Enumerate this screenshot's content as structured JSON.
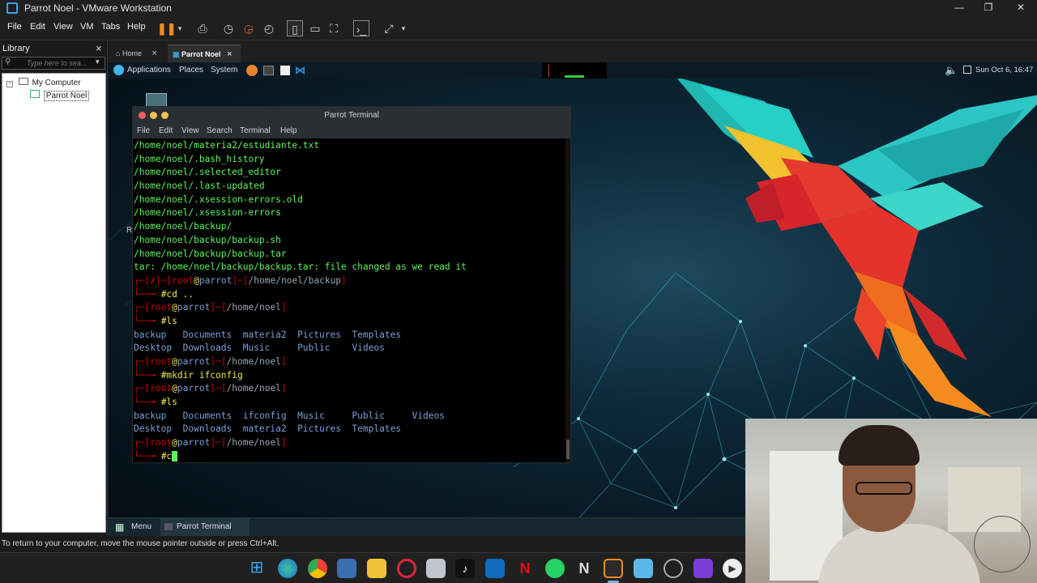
{
  "window": {
    "title": "Parrot Noel - VMware Workstation"
  },
  "menubar": {
    "items": [
      "File",
      "Edit",
      "View",
      "VM",
      "Tabs",
      "Help"
    ]
  },
  "library": {
    "header": "Library",
    "search_placeholder": "Type here to sea...",
    "tree": {
      "root": "My Computer",
      "child": "Parrot Noel"
    }
  },
  "vm_tabs": [
    {
      "label": "Home"
    },
    {
      "label": "Parrot Noel"
    }
  ],
  "guest_panel": {
    "menus": [
      "Applications",
      "Places",
      "System"
    ],
    "clock": "Sun Oct 6, 16:47"
  },
  "terminal": {
    "title": "Parrot Terminal",
    "menu": [
      "File",
      "Edit",
      "View",
      "Search",
      "Terminal",
      "Help"
    ],
    "output_lines": [
      "/home/noel/materia2/estudiante.txt",
      "/home/noel/.bash_history",
      "/home/noel/.selected_editor",
      "/home/noel/.last-updated",
      "/home/noel/.xsession-errors.old",
      "/home/noel/.xsession-errors",
      "/home/noel/backup/",
      "/home/noel/backup/backup.sh",
      "/home/noel/backup/backup.tar",
      "tar: /home/noel/backup/backup.tar: file changed as we read it"
    ],
    "prompt_user": "root",
    "prompt_host": "parrot",
    "error_mark": "✗",
    "cwd_backup": "/home/noel/backup",
    "cwd_home": "/home/noel",
    "cmd1": "#cd ..",
    "cmd2": "#ls",
    "ls1_row1": "backup   Documents  materia2  Pictures  Templates",
    "ls1_row2": "Desktop  Downloads  Music     Public    Videos",
    "cmd3": "#mkdir ifconfig",
    "cmd4": "#ls",
    "ls2_row1": "backup   Documents  ifconfig  Music     Public     Videos",
    "ls2_row2": "Desktop  Downloads  materia2  Pictures  Templates",
    "cmd5_typed": "#c"
  },
  "guest_taskbar": {
    "menu": "Menu",
    "task": "Parrot Terminal"
  },
  "host_status": "To return to your computer, move the mouse pointer outside or press Ctrl+Alt.",
  "colors": {
    "prompt_red": "#cc0000",
    "output_green": "#5df55d",
    "accent_blue": "#3fa0e0"
  }
}
